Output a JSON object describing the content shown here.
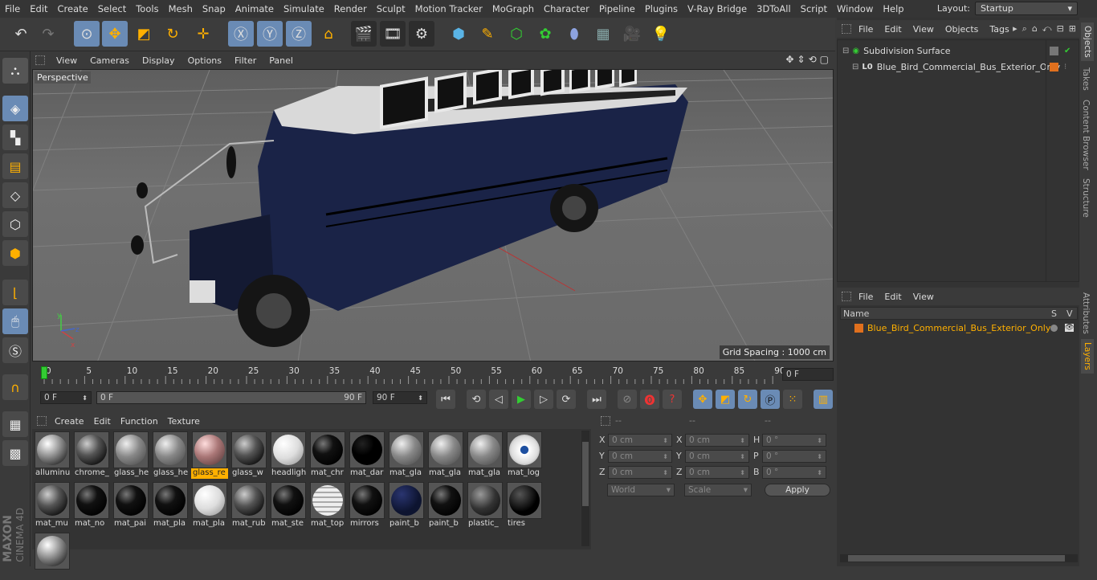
{
  "menubar": {
    "items": [
      "File",
      "Edit",
      "Create",
      "Select",
      "Tools",
      "Mesh",
      "Snap",
      "Animate",
      "Simulate",
      "Render",
      "Sculpt",
      "Motion Tracker",
      "MoGraph",
      "Character",
      "Pipeline",
      "Plugins",
      "V-Ray Bridge",
      "3DToAll",
      "Script",
      "Window",
      "Help"
    ],
    "layout_label": "Layout:",
    "layout_value": "Startup"
  },
  "viewport": {
    "menu": [
      "View",
      "Cameras",
      "Display",
      "Options",
      "Filter",
      "Panel"
    ],
    "camera_label": "Perspective",
    "grid_spacing": "Grid Spacing : 1000 cm"
  },
  "timeline": {
    "ticks": [
      "0",
      "5",
      "10",
      "15",
      "20",
      "25",
      "30",
      "35",
      "40",
      "45",
      "50",
      "55",
      "60",
      "65",
      "70",
      "75",
      "80",
      "85",
      "90"
    ],
    "current_frame": "0 F",
    "start_frame": "0 F",
    "range_start": "0 F",
    "range_end": "90 F",
    "end_frame": "90 F"
  },
  "material_manager": {
    "menu": [
      "Create",
      "Edit",
      "Function",
      "Texture"
    ],
    "materials": [
      {
        "name": "alluminu",
        "style": "chrome"
      },
      {
        "name": "chrome_",
        "style": "chrome-dark"
      },
      {
        "name": "glass_he",
        "style": "glass"
      },
      {
        "name": "glass_he",
        "style": "glass"
      },
      {
        "name": "glass_re",
        "style": "glass-red",
        "selected": true
      },
      {
        "name": "glass_w",
        "style": "chrome-dark"
      },
      {
        "name": "headligh",
        "style": "white"
      },
      {
        "name": "mat_chr",
        "style": "black-shiny"
      },
      {
        "name": "mat_dar",
        "style": "black"
      },
      {
        "name": "mat_gla",
        "style": "glass"
      },
      {
        "name": "mat_gla",
        "style": "glass"
      },
      {
        "name": "mat_gla",
        "style": "glass"
      },
      {
        "name": "mat_log",
        "style": "logo"
      },
      {
        "name": "mat_mu",
        "style": "chrome-dark"
      },
      {
        "name": "mat_no",
        "style": "black-shiny"
      },
      {
        "name": "mat_pai",
        "style": "black-shiny"
      },
      {
        "name": "mat_pla",
        "style": "black-shiny"
      },
      {
        "name": "mat_pla",
        "style": "white"
      },
      {
        "name": "mat_rub",
        "style": "chrome-dark"
      },
      {
        "name": "mat_ste",
        "style": "black-shiny"
      },
      {
        "name": "mat_top",
        "style": "striped"
      },
      {
        "name": "mirrors",
        "style": "black-shiny"
      },
      {
        "name": "paint_b",
        "style": "navy"
      },
      {
        "name": "paint_b",
        "style": "black-shiny"
      },
      {
        "name": "plastic_",
        "style": "dark-grey"
      },
      {
        "name": "tires",
        "style": "star"
      },
      {
        "name": "",
        "style": "chrome"
      }
    ]
  },
  "coordinates": {
    "header": [
      "--",
      "--",
      "--"
    ],
    "rows": [
      {
        "l1": "X",
        "v1": "0 cm",
        "l2": "X",
        "v2": "0 cm",
        "l3": "H",
        "v3": "0 °"
      },
      {
        "l1": "Y",
        "v1": "0 cm",
        "l2": "Y",
        "v2": "0 cm",
        "l3": "P",
        "v3": "0 °"
      },
      {
        "l1": "Z",
        "v1": "0 cm",
        "l2": "Z",
        "v2": "0 cm",
        "l3": "B",
        "v3": "0 °"
      }
    ],
    "space": "World",
    "mode": "Scale",
    "apply": "Apply"
  },
  "object_manager": {
    "menu": [
      "File",
      "Edit",
      "View",
      "Objects",
      "Tags"
    ],
    "objects": [
      {
        "name": "Subdivision Surface",
        "indent": 0
      },
      {
        "name": "Blue_Bird_Commercial_Bus_Exterior_Only",
        "indent": 1
      }
    ]
  },
  "layer_manager": {
    "menu": [
      "File",
      "Edit",
      "View"
    ],
    "col_name": "Name",
    "col_s": "S",
    "col_v": "V",
    "layers": [
      "Blue_Bird_Commercial_Bus_Exterior_Only"
    ]
  },
  "side_tabs": [
    "Objects",
    "Takes",
    "Content Browser",
    "Structure",
    "Attributes",
    "Layers"
  ],
  "brand": {
    "line1": "MAXON",
    "line2": "CINEMA 4D"
  },
  "colors": {
    "accent": "#6a8bb5",
    "selected": "#ffb000",
    "layer_color": "#e0701e",
    "bus_blue": "#1a2347"
  }
}
